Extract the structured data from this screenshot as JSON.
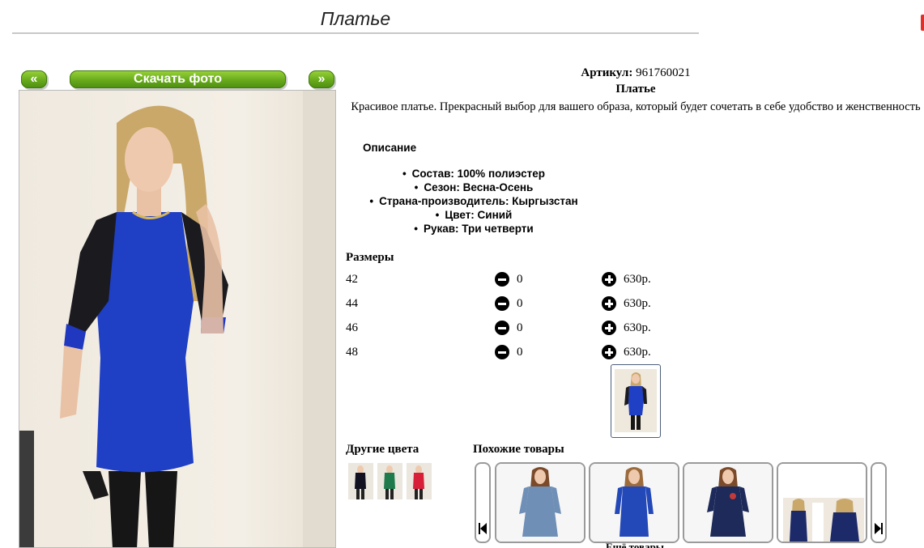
{
  "page": {
    "title": "Платье"
  },
  "gallery": {
    "prev_label": "«",
    "download_label": "Скачать фото",
    "next_label": "»"
  },
  "product": {
    "article_label": "Артикул:",
    "article_value": "961760021",
    "name": "Платье",
    "description": "Красивое платье. Прекрасный выбор для вашего образа, который будет сочетать в себе удобство и женственность"
  },
  "description_section": {
    "heading": "Описание",
    "properties": [
      "Состав: 100% полиэстер",
      "Сезон: Весна-Осень",
      "Страна-производитель: Кыргызстан",
      "Цвет: Синий",
      "Рукав: Три четверти"
    ]
  },
  "sizes": {
    "heading": "Размеры",
    "rows": [
      {
        "size": "42",
        "qty": "0",
        "price": "630р."
      },
      {
        "size": "44",
        "qty": "0",
        "price": "630р."
      },
      {
        "size": "46",
        "qty": "0",
        "price": "630р."
      },
      {
        "size": "48",
        "qty": "0",
        "price": "630р."
      }
    ]
  },
  "other_colors": {
    "heading": "Другие цвета",
    "colors": [
      "#111122",
      "#1f7a4c",
      "#d81f3a"
    ]
  },
  "similar": {
    "heading": "Похожие товары",
    "more_label": "Ещё товары"
  },
  "icons": {
    "minus": "minus-circle-icon",
    "plus": "plus-circle-icon",
    "carousel_prev": "skip-back-icon",
    "carousel_next": "skip-forward-icon"
  }
}
